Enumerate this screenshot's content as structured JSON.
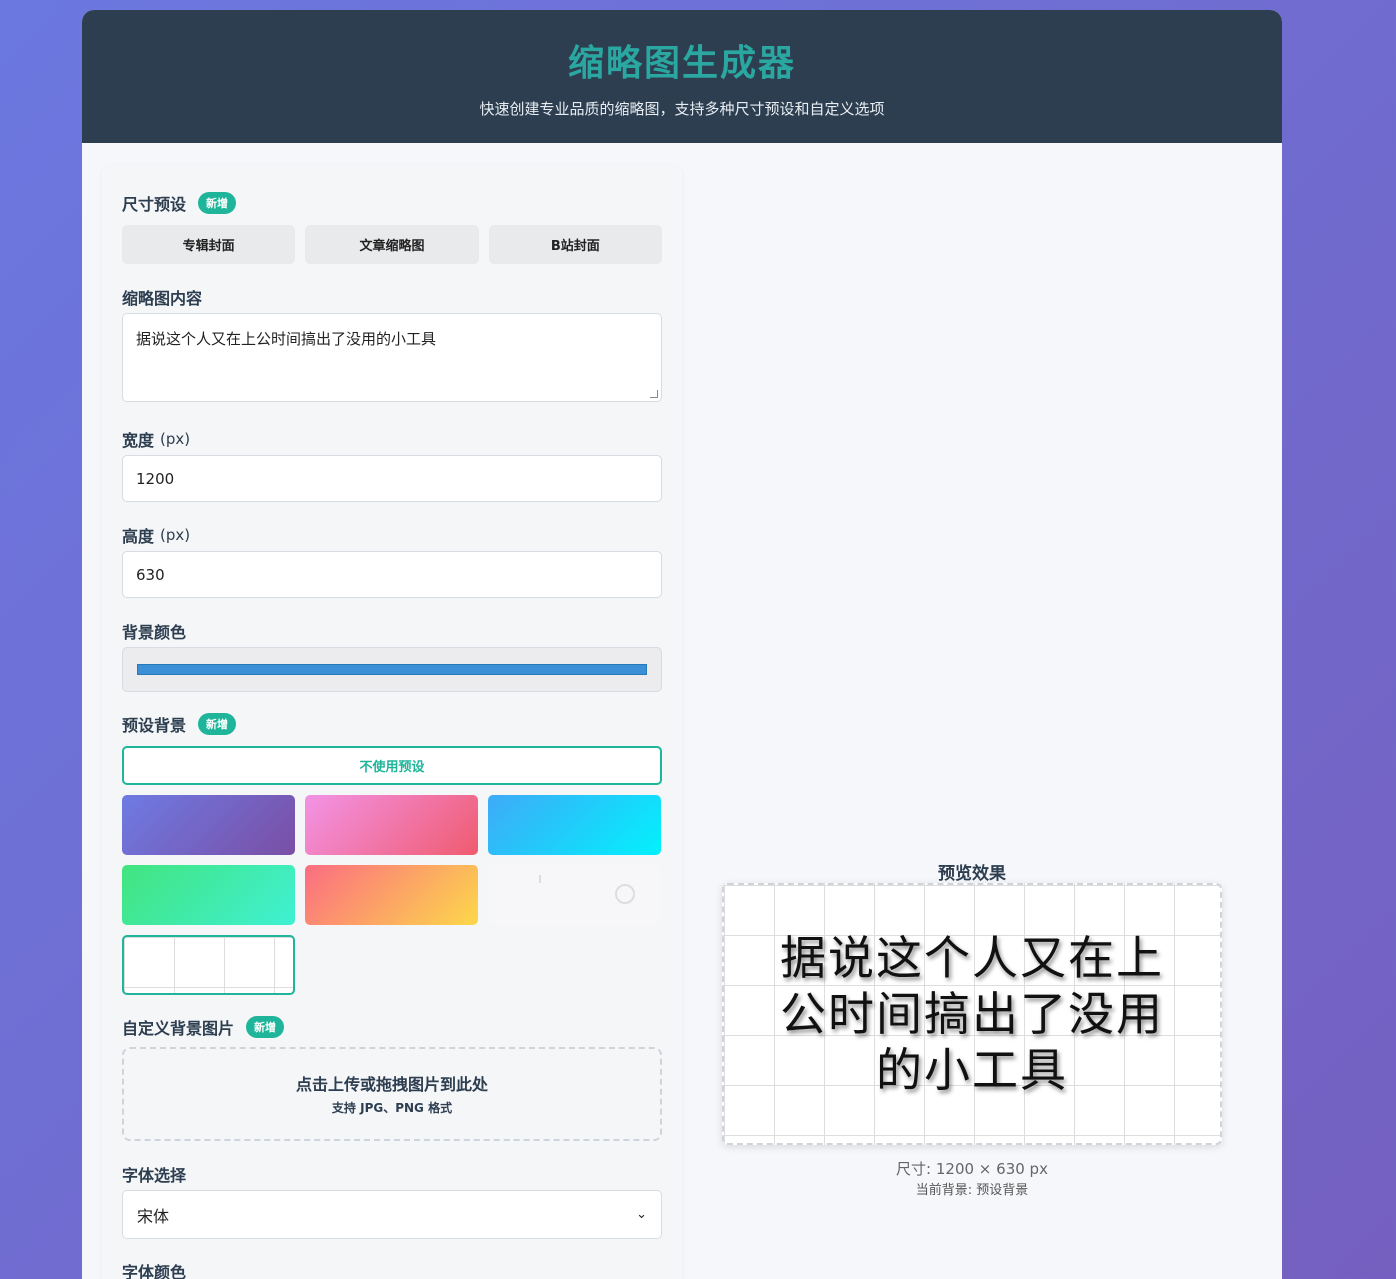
{
  "header": {
    "title": "缩略图生成器",
    "subtitle": "快速创建专业品质的缩略图，支持多种尺寸预设和自定义选项"
  },
  "size_presets": {
    "label": "尺寸预设",
    "badge": "新增",
    "buttons": [
      "专辑封面",
      "文章缩略图",
      "B站封面"
    ]
  },
  "content": {
    "label": "缩略图内容",
    "value": "据说这个人又在上公时间搞出了没用的小工具"
  },
  "width": {
    "label": "宽度",
    "unit": "(px)",
    "value": "1200"
  },
  "height": {
    "label": "高度",
    "unit": "(px)",
    "value": "630"
  },
  "bg_color": {
    "label": "背景颜色",
    "value": "#3a8fd6"
  },
  "preset_bg": {
    "label": "预设背景",
    "badge": "新增",
    "none_label": "不使用预设",
    "swatches": [
      "linear-gradient(135deg, #6e7be3, #7a4ea5)",
      "linear-gradient(135deg, #f293e6, #f05b6f)",
      "linear-gradient(135deg, #3eaaf7, #02f1fd)",
      "linear-gradient(135deg, #42e47e, #3ff1d3)",
      "linear-gradient(135deg, #fb6d82, #fdd84a)"
    ]
  },
  "custom_bg": {
    "label": "自定义背景图片",
    "badge": "新增",
    "upload_title": "点击上传或拖拽图片到此处",
    "upload_hint": "支持 JPG、PNG 格式"
  },
  "font": {
    "label": "字体选择",
    "value": "宋体"
  },
  "font_color": {
    "label": "字体颜色"
  },
  "preview": {
    "title": "预览效果",
    "text": "据说这个人又在上公时间搞出了没用的小工具",
    "size_text": "尺寸: 1200 × 630 px",
    "bg_text": "当前背景: 预设背景"
  }
}
